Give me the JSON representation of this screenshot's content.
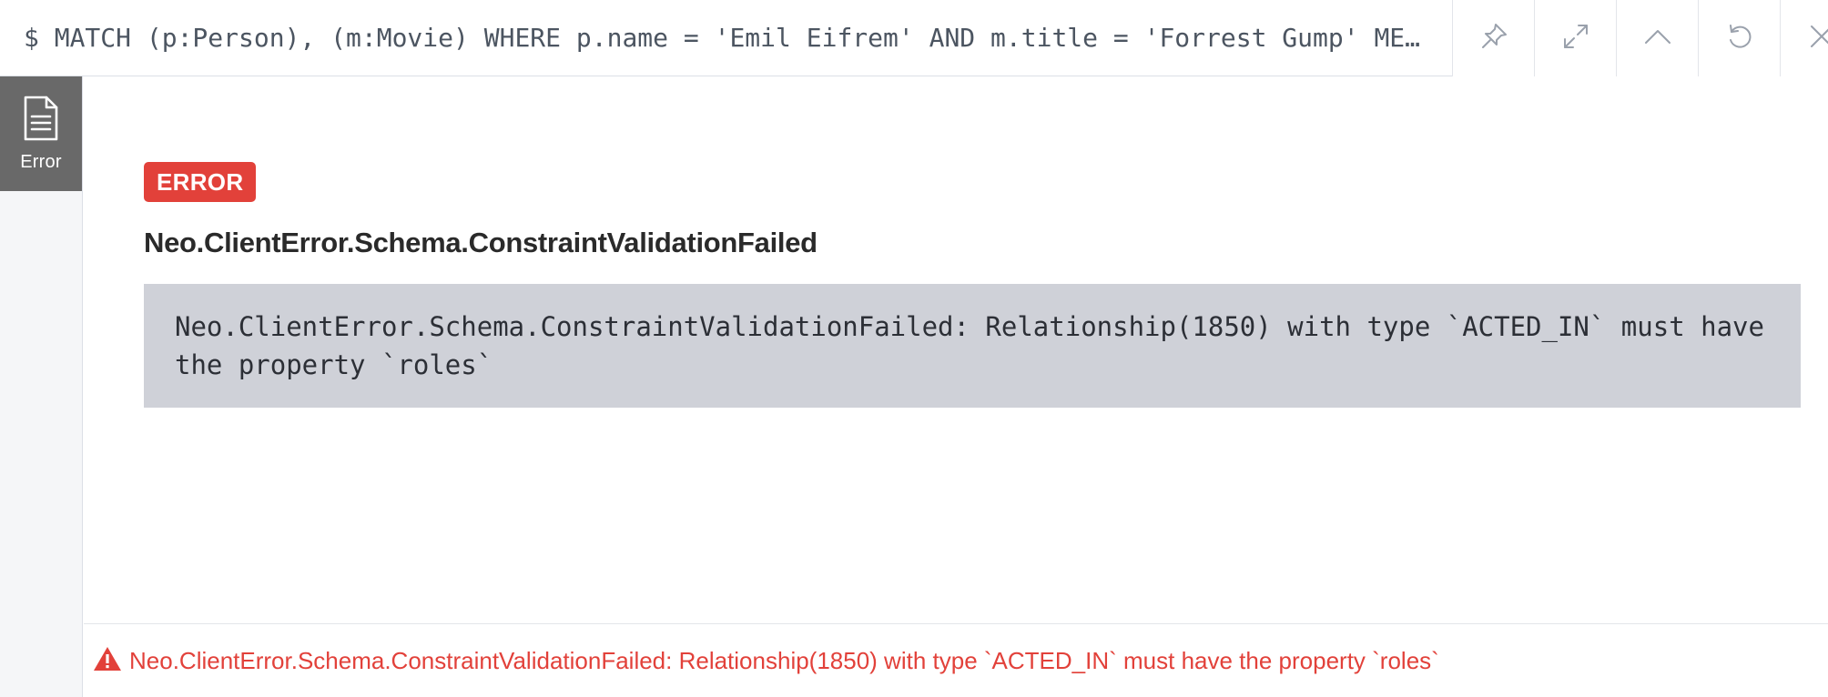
{
  "editor": {
    "query": "$ MATCH (p:Person), (m:Movie) WHERE p.name = 'Emil Eifrem' AND m.title = 'Forrest Gump' ME…",
    "actions": [
      {
        "name": "pin-icon"
      },
      {
        "name": "expand-icon"
      },
      {
        "name": "collapse-icon"
      },
      {
        "name": "rerun-icon"
      },
      {
        "name": "close-icon"
      }
    ]
  },
  "sidebar": {
    "tab_label": "Error",
    "tab_icon": "document-icon"
  },
  "result": {
    "badge": "ERROR",
    "title": "Neo.ClientError.Schema.ConstraintValidationFailed",
    "message": "Neo.ClientError.Schema.ConstraintValidationFailed: Relationship(1850) with type `ACTED_IN` must have the property `roles`"
  },
  "status": {
    "icon": "warning-icon",
    "text": "Neo.ClientError.Schema.ConstraintValidationFailed: Relationship(1850) with type `ACTED_IN` must have the property `roles`"
  },
  "colors": {
    "error_red": "#e2413a",
    "sidebar_tab": "#696969",
    "message_box": "#cfd1d8"
  }
}
